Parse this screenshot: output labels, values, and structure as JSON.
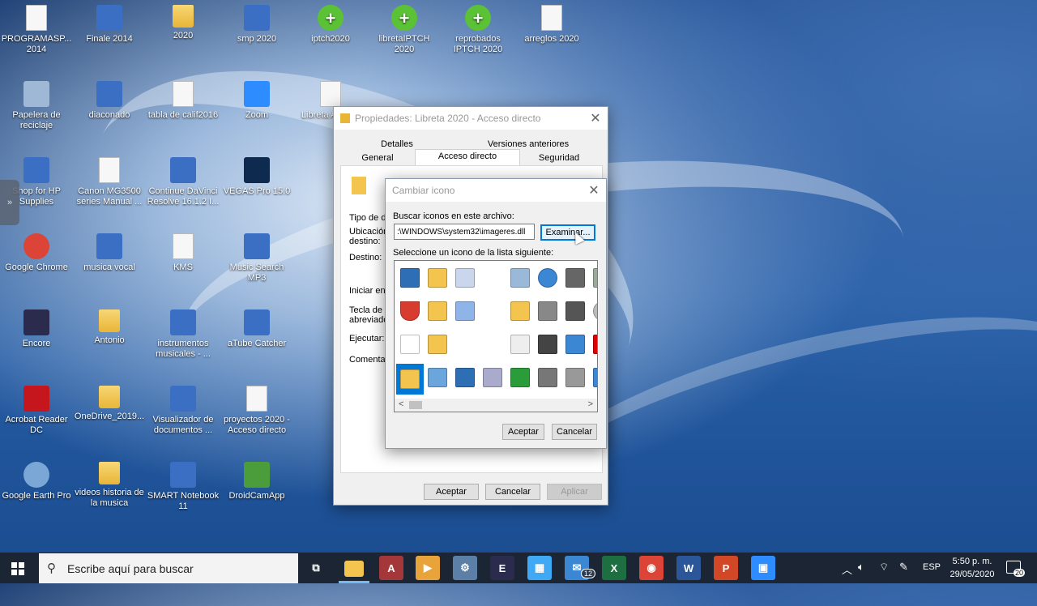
{
  "desktop_icons": [
    {
      "label": "PROGRAMASP... 2014"
    },
    {
      "label": "Finale 2014"
    },
    {
      "label": "2020"
    },
    {
      "label": "smp 2020"
    },
    {
      "label": "iptch2020"
    },
    {
      "label": "libretaIPTCH 2020"
    },
    {
      "label": "reprobados IPTCH 2020"
    },
    {
      "label": "arreglos 2020"
    },
    {
      "label": "Papelera de reciclaje"
    },
    {
      "label": "diaconado"
    },
    {
      "label": "tabla de calif2016"
    },
    {
      "label": "Zoom"
    },
    {
      "label": "Libreta Acceso"
    },
    {
      "label": "Shop for HP Supplies"
    },
    {
      "label": "Canon MG3500 series Manual ..."
    },
    {
      "label": "Continue DaVinci Resolve 16.1.2 I..."
    },
    {
      "label": "VEGAS Pro 15.0"
    },
    {
      "label": "Google Chrome"
    },
    {
      "label": "musica vocal"
    },
    {
      "label": "KMS"
    },
    {
      "label": "Music Search MP3"
    },
    {
      "label": "Encore"
    },
    {
      "label": "Antonio"
    },
    {
      "label": "instrumentos musicales - ..."
    },
    {
      "label": "aTube Catcher"
    },
    {
      "label": "Acrobat Reader DC"
    },
    {
      "label": "OneDrive_2019..."
    },
    {
      "label": "Visualizador de documentos ..."
    },
    {
      "label": "proyectos 2020 - Acceso directo"
    },
    {
      "label": "Google Earth Pro"
    },
    {
      "label": "videos historia de la musica"
    },
    {
      "label": "SMART Notebook 11"
    },
    {
      "label": "DroidCamApp"
    }
  ],
  "props": {
    "title": "Propiedades: Libreta 2020 - Acceso directo",
    "tabs": [
      "Detalles",
      "Versiones anteriores",
      "General",
      "Acceso directo",
      "Seguridad"
    ],
    "fields": [
      "Tipo de d",
      "Ubicación destino:",
      "Destino:",
      "Iniciar en:",
      "Tecla de abreviado",
      "Ejecutar:",
      "Comentar"
    ],
    "ok": "Aceptar",
    "cancel": "Cancelar",
    "apply": "Aplicar"
  },
  "change_icon": {
    "title": "Cambiar icono",
    "search_label": "Buscar iconos en este archivo:",
    "path_value": ":\\WINDOWS\\system32\\imageres.dll",
    "browse": "Examinar...",
    "list_label": "Seleccione un icono de la lista siguiente:",
    "ok": "Aceptar",
    "cancel": "Cancelar"
  },
  "taskbar": {
    "search_placeholder": "Escribe aquí para buscar",
    "lang": "ESP",
    "time": "5:50 p. m.",
    "date": "29/05/2020",
    "mail_badge": "12",
    "notif_badge": "20"
  }
}
